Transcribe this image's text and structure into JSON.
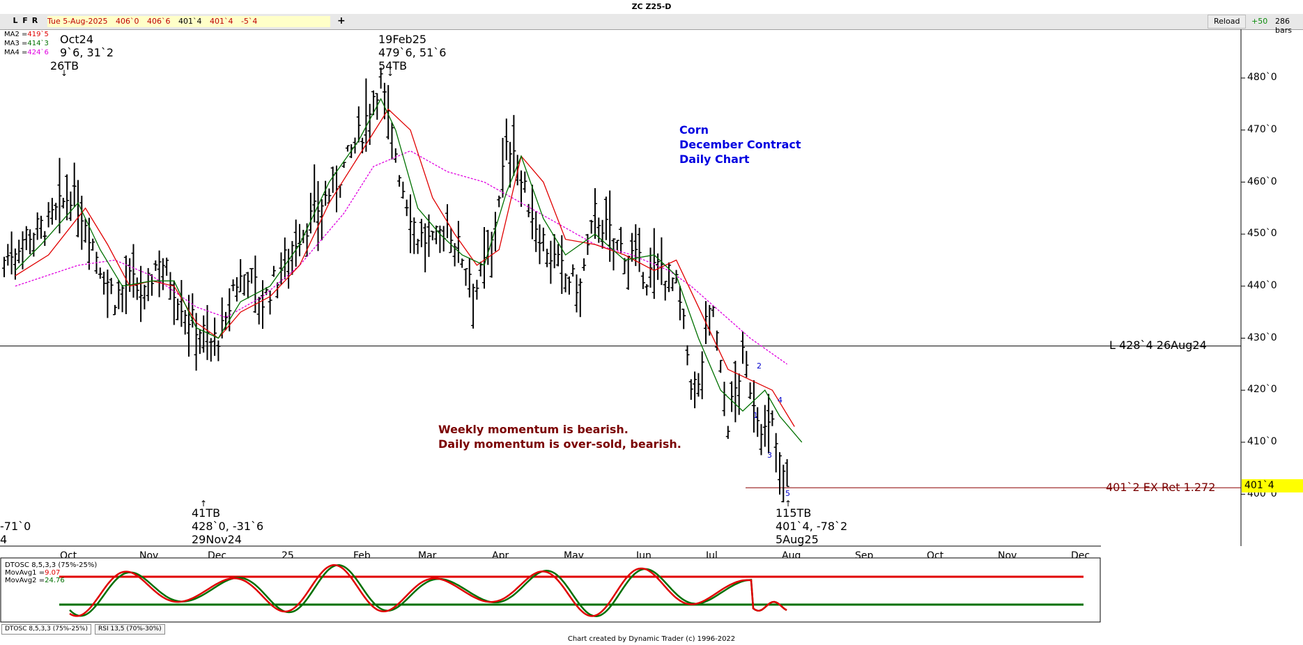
{
  "window": {
    "title": "ZC Z25-D"
  },
  "toolbar": {
    "lfr": [
      "L",
      "F",
      "R"
    ],
    "quote": {
      "date": "Tue 5-Aug-2025",
      "open": "406`0",
      "high": "406`6",
      "low": "401`4",
      "close": "401`4",
      "change": "-5`4"
    },
    "add_label": "+",
    "reload_label": "Reload",
    "plus_label": "+50",
    "bars_label": "286 bars"
  },
  "ma_legend": [
    {
      "name": "MA2 =",
      "value": "419`5",
      "color": "#e00000"
    },
    {
      "name": "MA3 =",
      "value": "414`3",
      "color": "#007000"
    },
    {
      "name": "MA4 =",
      "value": "424`6",
      "color": "#e000e0"
    }
  ],
  "price_axis": [
    "480`0",
    "470`0",
    "460`0",
    "450`0",
    "440`0",
    "430`0",
    "420`0",
    "410`0",
    "400`0"
  ],
  "month_axis": [
    "Oct",
    "Nov",
    "Dec",
    "25",
    "Feb",
    "Mar",
    "Apr",
    "May",
    "Jun",
    "Jul",
    "Aug",
    "Sep",
    "Oct",
    "Nov",
    "Dec"
  ],
  "annotations": {
    "top_left": [
      "Oct24",
      "9`6, 31`2",
      "26TB"
    ],
    "feb_high": [
      "19Feb25",
      "479`6, 51`6",
      "54TB"
    ],
    "nov_low": [
      "41TB",
      "428`0, -31`6",
      "29Nov24"
    ],
    "aug_low": [
      "115TB",
      "401`4, -78`2",
      "5Aug25"
    ],
    "left_edge": [
      "-71`0",
      "4"
    ]
  },
  "chart_title": [
    "Corn",
    "December Contract",
    "Daily Chart"
  ],
  "momentum_text": [
    "Weekly momentum is bearish.",
    "Daily momentum is over-sold, bearish."
  ],
  "horizontal_lines": [
    {
      "price": 428.5,
      "label": "L 428`4 26Aug24",
      "color": "#000000"
    },
    {
      "price": 401.25,
      "label": "401`2 EX Ret 1.272",
      "color": "#8b0000"
    }
  ],
  "last_price_tag": "401`4",
  "wave_labels": [
    "1",
    "2",
    "3",
    "4",
    "5"
  ],
  "oscillator": {
    "legend": [
      {
        "name": "DTOSC 8,5,3,3 (75%-25%)",
        "value": "",
        "color": "#000000"
      },
      {
        "name": "MovAvg1 =",
        "value": "9.07",
        "color": "#e00000"
      },
      {
        "name": "MovAvg2 =",
        "value": "24.76",
        "color": "#007000"
      }
    ],
    "tabs": [
      "DTOSC 8,5,3,3 (75%-25%)",
      "RSI 13,5 (70%-30%)"
    ]
  },
  "footer": "Chart created by Dynamic Trader  (c)  1996-2022",
  "chart_data": {
    "type": "ohlc",
    "ylim": [
      393,
      484
    ],
    "y_ticks": [
      400,
      410,
      420,
      430,
      440,
      450,
      460,
      470,
      480
    ],
    "close_path": [
      [
        0,
        445
      ],
      [
        6,
        450
      ],
      [
        12,
        452
      ],
      [
        18,
        458
      ],
      [
        22,
        453
      ],
      [
        26,
        444
      ],
      [
        30,
        438
      ],
      [
        34,
        441
      ],
      [
        38,
        438
      ],
      [
        42,
        446
      ],
      [
        46,
        440
      ],
      [
        50,
        434
      ],
      [
        54,
        431
      ],
      [
        56,
        429
      ],
      [
        60,
        432
      ],
      [
        62,
        440
      ],
      [
        66,
        443
      ],
      [
        70,
        437
      ],
      [
        74,
        442
      ],
      [
        78,
        448
      ],
      [
        82,
        452
      ],
      [
        86,
        456
      ],
      [
        90,
        460
      ],
      [
        94,
        466
      ],
      [
        97,
        470
      ],
      [
        100,
        477
      ],
      [
        102,
        479.5
      ],
      [
        104,
        472
      ],
      [
        106,
        466
      ],
      [
        108,
        459
      ],
      [
        112,
        450
      ],
      [
        116,
        448
      ],
      [
        120,
        452
      ],
      [
        124,
        446
      ],
      [
        128,
        440
      ],
      [
        132,
        448
      ],
      [
        134,
        458
      ],
      [
        136,
        466
      ],
      [
        138,
        468
      ],
      [
        140,
        460
      ],
      [
        144,
        452
      ],
      [
        148,
        446
      ],
      [
        152,
        442
      ],
      [
        156,
        440
      ],
      [
        160,
        454
      ],
      [
        162,
        452
      ],
      [
        166,
        448
      ],
      [
        170,
        446
      ],
      [
        174,
        442
      ],
      [
        178,
        444
      ],
      [
        182,
        440
      ],
      [
        184,
        432
      ],
      [
        186,
        422
      ],
      [
        188,
        420
      ],
      [
        190,
        432
      ],
      [
        192,
        436
      ],
      [
        194,
        424
      ],
      [
        196,
        414
      ],
      [
        198,
        420
      ],
      [
        200,
        426
      ],
      [
        202,
        421
      ],
      [
        204,
        416
      ],
      [
        206,
        412
      ],
      [
        208,
        413
      ],
      [
        210,
        406
      ],
      [
        212,
        401.5
      ]
    ],
    "ma2": [
      [
        3,
        442
      ],
      [
        12,
        446
      ],
      [
        22,
        455
      ],
      [
        28,
        448
      ],
      [
        34,
        440
      ],
      [
        40,
        441
      ],
      [
        46,
        440
      ],
      [
        52,
        433
      ],
      [
        58,
        430
      ],
      [
        64,
        435
      ],
      [
        72,
        438
      ],
      [
        80,
        444
      ],
      [
        88,
        456
      ],
      [
        96,
        465
      ],
      [
        104,
        474
      ],
      [
        110,
        470
      ],
      [
        116,
        457
      ],
      [
        122,
        450
      ],
      [
        128,
        444
      ],
      [
        134,
        447
      ],
      [
        140,
        465
      ],
      [
        146,
        460
      ],
      [
        152,
        449
      ],
      [
        160,
        448
      ],
      [
        168,
        446
      ],
      [
        176,
        443
      ],
      [
        182,
        445
      ],
      [
        188,
        436
      ],
      [
        196,
        424
      ],
      [
        202,
        422
      ],
      [
        208,
        420
      ],
      [
        214,
        413
      ]
    ],
    "ma3": [
      [
        3,
        443
      ],
      [
        10,
        448
      ],
      [
        20,
        456
      ],
      [
        26,
        447
      ],
      [
        32,
        440
      ],
      [
        40,
        441
      ],
      [
        46,
        441
      ],
      [
        52,
        432
      ],
      [
        58,
        430
      ],
      [
        64,
        437
      ],
      [
        72,
        440
      ],
      [
        80,
        448
      ],
      [
        88,
        460
      ],
      [
        96,
        468
      ],
      [
        102,
        476
      ],
      [
        106,
        470
      ],
      [
        112,
        455
      ],
      [
        118,
        450
      ],
      [
        124,
        446
      ],
      [
        130,
        444
      ],
      [
        136,
        458
      ],
      [
        140,
        465
      ],
      [
        146,
        453
      ],
      [
        152,
        446
      ],
      [
        160,
        450
      ],
      [
        168,
        445
      ],
      [
        176,
        446
      ],
      [
        182,
        442
      ],
      [
        188,
        430
      ],
      [
        194,
        420
      ],
      [
        200,
        416
      ],
      [
        206,
        420
      ],
      [
        210,
        415
      ],
      [
        216,
        410
      ]
    ],
    "ma4": [
      [
        3,
        440
      ],
      [
        20,
        444
      ],
      [
        30,
        445
      ],
      [
        40,
        442
      ],
      [
        52,
        436
      ],
      [
        60,
        434
      ],
      [
        70,
        438
      ],
      [
        80,
        444
      ],
      [
        92,
        454
      ],
      [
        100,
        463
      ],
      [
        110,
        466
      ],
      [
        120,
        462
      ],
      [
        130,
        460
      ],
      [
        140,
        456
      ],
      [
        150,
        452
      ],
      [
        160,
        448
      ],
      [
        170,
        446
      ],
      [
        180,
        443
      ],
      [
        186,
        440
      ],
      [
        194,
        435
      ],
      [
        202,
        430
      ],
      [
        212,
        425
      ]
    ],
    "oscillator_levels": [
      75,
      25
    ]
  }
}
